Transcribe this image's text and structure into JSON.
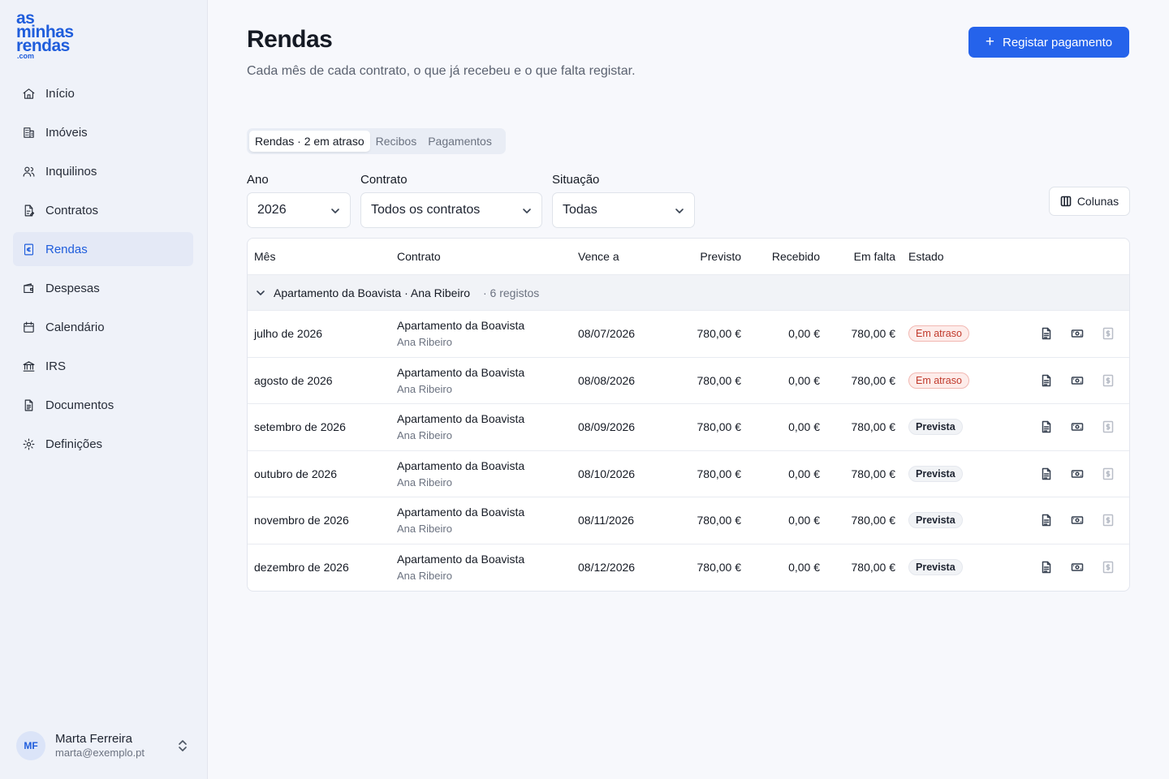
{
  "brand": {
    "line1": "as",
    "line2": "minhas",
    "line3": "rendas",
    "suffix": ".com",
    "color": "#1f5ddc"
  },
  "sidebar": {
    "items": [
      {
        "label": "Início",
        "icon": "home-icon",
        "active": false
      },
      {
        "label": "Imóveis",
        "icon": "building-icon",
        "active": false
      },
      {
        "label": "Inquilinos",
        "icon": "users-icon",
        "active": false
      },
      {
        "label": "Contratos",
        "icon": "contract-icon",
        "active": false
      },
      {
        "label": "Rendas",
        "icon": "euro-receipt-icon",
        "active": true
      },
      {
        "label": "Despesas",
        "icon": "wallet-icon",
        "active": false
      },
      {
        "label": "Calendário",
        "icon": "calendar-icon",
        "active": false
      },
      {
        "label": "IRS",
        "icon": "bank-icon",
        "active": false
      },
      {
        "label": "Documentos",
        "icon": "document-icon",
        "active": false
      },
      {
        "label": "Definições",
        "icon": "gear-icon",
        "active": false
      }
    ]
  },
  "user": {
    "initials": "MF",
    "name": "Marta Ferreira",
    "email": "marta@exemplo.pt"
  },
  "header": {
    "title": "Rendas",
    "subtitle": "Cada mês de cada contrato, o que já recebeu e o que falta registar.",
    "primary_button": "Registar pagamento"
  },
  "tabs": [
    {
      "label": "Rendas · 2 em atraso",
      "active": true
    },
    {
      "label": "Recibos",
      "active": false
    },
    {
      "label": "Pagamentos",
      "active": false
    }
  ],
  "filters": {
    "year": {
      "label": "Ano",
      "value": "2026"
    },
    "contract": {
      "label": "Contrato",
      "value": "Todos os contratos"
    },
    "status": {
      "label": "Situação",
      "value": "Todas"
    }
  },
  "columns_button": "Colunas",
  "table": {
    "headers": {
      "mes": "Mês",
      "contrato": "Contrato",
      "vence": "Vence a",
      "previsto": "Previsto",
      "recebido": "Recebido",
      "falta": "Em falta",
      "estado": "Estado"
    },
    "group": {
      "title": "Apartamento da Boavista · Ana Ribeiro",
      "count": "· 6 registos"
    },
    "rows": [
      {
        "mes": "julho de 2026",
        "imovel": "Apartamento da Boavista",
        "inquilino": "Ana Ribeiro",
        "vence": "08/07/2026",
        "previsto": "780,00 €",
        "recebido": "0,00 €",
        "falta": "780,00 €",
        "estado": "Em atraso",
        "estado_tipo": "late"
      },
      {
        "mes": "agosto de 2026",
        "imovel": "Apartamento da Boavista",
        "inquilino": "Ana Ribeiro",
        "vence": "08/08/2026",
        "previsto": "780,00 €",
        "recebido": "0,00 €",
        "falta": "780,00 €",
        "estado": "Em atraso",
        "estado_tipo": "late"
      },
      {
        "mes": "setembro de 2026",
        "imovel": "Apartamento da Boavista",
        "inquilino": "Ana Ribeiro",
        "vence": "08/09/2026",
        "previsto": "780,00 €",
        "recebido": "0,00 €",
        "falta": "780,00 €",
        "estado": "Prevista",
        "estado_tipo": "plan"
      },
      {
        "mes": "outubro de 2026",
        "imovel": "Apartamento da Boavista",
        "inquilino": "Ana Ribeiro",
        "vence": "08/10/2026",
        "previsto": "780,00 €",
        "recebido": "0,00 €",
        "falta": "780,00 €",
        "estado": "Prevista",
        "estado_tipo": "plan"
      },
      {
        "mes": "novembro de 2026",
        "imovel": "Apartamento da Boavista",
        "inquilino": "Ana Ribeiro",
        "vence": "08/11/2026",
        "previsto": "780,00 €",
        "recebido": "0,00 €",
        "falta": "780,00 €",
        "estado": "Prevista",
        "estado_tipo": "plan"
      },
      {
        "mes": "dezembro de 2026",
        "imovel": "Apartamento da Boavista",
        "inquilino": "Ana Ribeiro",
        "vence": "08/12/2026",
        "previsto": "780,00 €",
        "recebido": "0,00 €",
        "falta": "780,00 €",
        "estado": "Prevista",
        "estado_tipo": "plan"
      }
    ]
  },
  "colors": {
    "accent": "#2563eb",
    "late_text": "#c0392b",
    "late_bg": "#fdecea"
  }
}
